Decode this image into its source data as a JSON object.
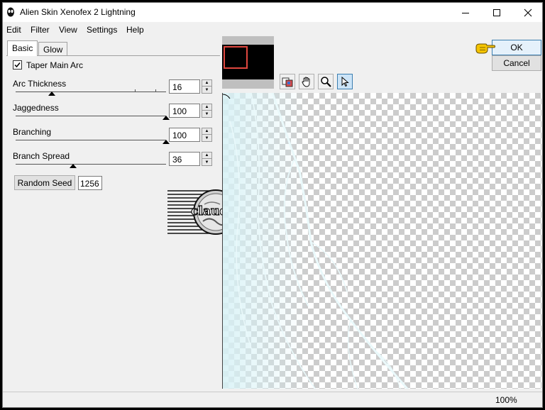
{
  "window": {
    "title": "Alien Skin Xenofex 2 Lightning"
  },
  "menu": [
    "Edit",
    "Filter",
    "View",
    "Settings",
    "Help"
  ],
  "tabs": [
    {
      "label": "Basic",
      "active": true
    },
    {
      "label": "Glow",
      "active": false
    }
  ],
  "taper": {
    "label": "Taper Main Arc",
    "checked": true
  },
  "sliders": [
    {
      "label": "Arc Thickness",
      "value": "16",
      "level": 0.24
    },
    {
      "label": "Jaggedness",
      "value": "100",
      "level": 1.0
    },
    {
      "label": "Branching",
      "value": "100",
      "level": 1.0
    },
    {
      "label": "Branch Spread",
      "value": "36",
      "level": 0.38
    }
  ],
  "random_seed": {
    "button_label": "Random Seed",
    "value": "1256"
  },
  "watermark_text": "claudia",
  "buttons": {
    "ok": "OK",
    "cancel": "Cancel"
  },
  "status": {
    "zoom": "100%"
  },
  "colors": {
    "accent_selection": "#3c7fb1",
    "preview_rect": "#e0473f",
    "pointer_hand": "#f5c400",
    "lightning": "#d8f2f6"
  },
  "icons": [
    "app-icon",
    "minimize-icon",
    "maximize-icon",
    "close-icon",
    "checkmark-icon",
    "preview-mode-icon",
    "hand-tool-icon",
    "zoom-tool-icon",
    "pointer-tool-icon",
    "pointing-hand-icon"
  ]
}
